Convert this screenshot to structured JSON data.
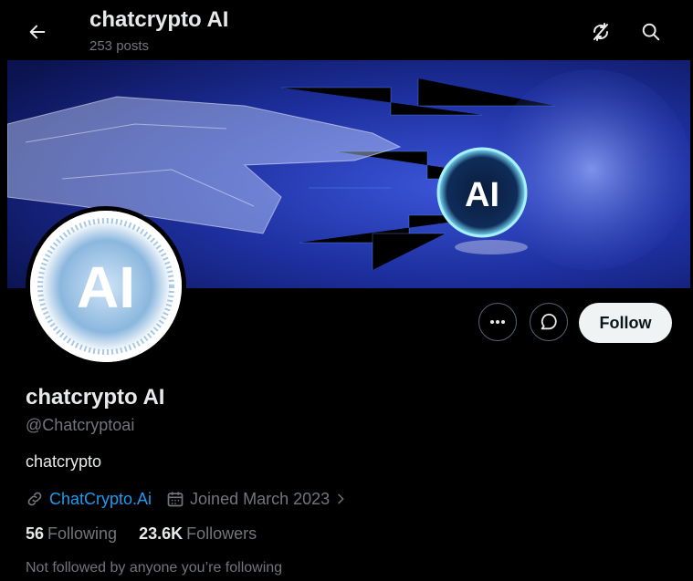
{
  "header": {
    "title": "chatcrypto AI",
    "posts_count": "253 posts",
    "icons": [
      "back-arrow-icon",
      "refresh-off-icon",
      "search-icon"
    ]
  },
  "banner": {
    "text": "AI"
  },
  "avatar": {
    "text": "AI"
  },
  "actions": {
    "more_icon": "more-dots-icon",
    "message_icon": "message-icon",
    "follow_label": "Follow"
  },
  "profile": {
    "display_name": "chatcrypto AI",
    "handle": "@Chatcryptoai",
    "bio": "chatcrypto",
    "website": "ChatCrypto.Ai",
    "joined": "Joined March 2023",
    "following_count": "56",
    "following_label": "Following",
    "followers_count": "23.6K",
    "followers_label": "Followers",
    "not_followed_text": "Not followed by anyone you’re following"
  },
  "colors": {
    "background": "#000000",
    "text": "#e7e9ea",
    "muted": "#71767b",
    "link": "#1d9bf0",
    "follow_bg": "#eff3f4"
  }
}
